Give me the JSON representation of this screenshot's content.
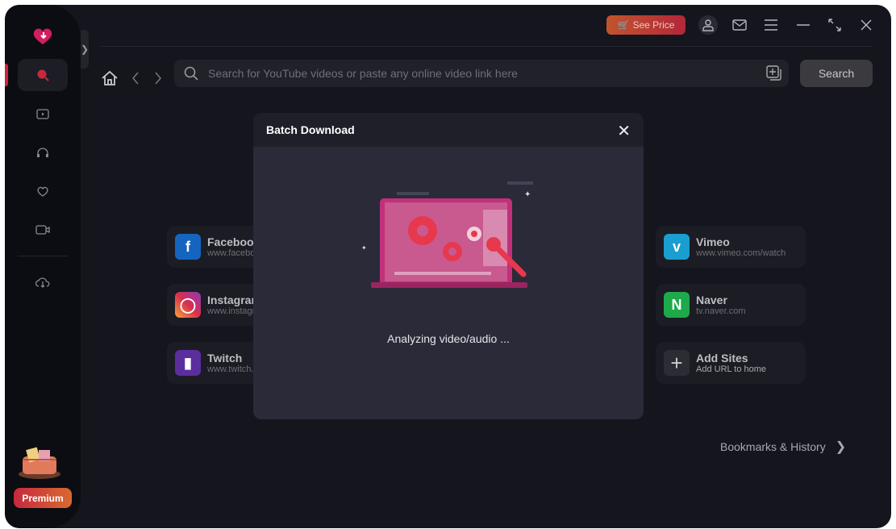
{
  "header": {
    "see_price": "See Price",
    "icons": [
      "cart-icon",
      "user-icon",
      "mail-icon",
      "menu-icon",
      "minimize-icon",
      "restore-icon",
      "close-icon"
    ]
  },
  "sidebar": {
    "items": [
      "search",
      "video",
      "audio",
      "favorites",
      "recordings",
      "downloads"
    ],
    "premium": "Premium",
    "accent": "#d0213f"
  },
  "search": {
    "placeholder": "Search for YouTube videos or paste any online video link here",
    "button": "Search"
  },
  "sites": [
    {
      "name": "Facebook",
      "url": "www.facebook.com",
      "color": "#1877f2"
    },
    {
      "name": "Instagram",
      "url": "www.instagram.com",
      "color": "#e1306c"
    },
    {
      "name": "Twitch",
      "url": "www.twitch.tv",
      "color": "#6441a5"
    },
    {
      "name": "Vimeo",
      "url": "www.vimeo.com/watch",
      "color": "#1ab7ea"
    },
    {
      "name": "Naver",
      "url": "tv.naver.com",
      "color": "#03c75a"
    },
    {
      "name": "Add Sites",
      "url": "Add URL to home",
      "color": "#3a3a42"
    }
  ],
  "bookmarks": "Bookmarks & History",
  "modal": {
    "title": "Batch Download",
    "status": "Analyzing video/audio ..."
  }
}
